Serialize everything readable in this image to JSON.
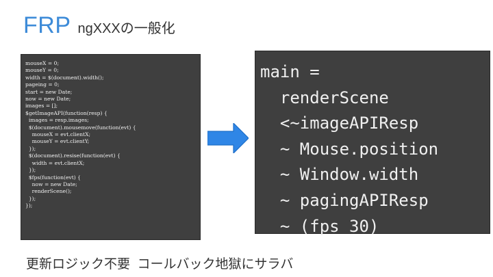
{
  "title": {
    "main": "FRP",
    "sub": "ngXXXの一般化"
  },
  "left_code": {
    "lines": [
      "mouseX = 0;",
      "mouseY = 0;",
      "width = $(document).width();",
      "pageing = 0;",
      "start = new Date;",
      "now = new Date;",
      "images = [];",
      "$getImageAPI(function(resp) {",
      "  images = resp.images;",
      "  $(document).mousemove(function(evt) {",
      "    mouseX = evt.clientX;",
      "    mouseY = evt.clientY;",
      "  });",
      "  $(document).resise(function(evt) {",
      "    width = evt.clientX;",
      "  });",
      "  $fps(function(evt) {",
      "    now = new Date;",
      "    renderScene();",
      "  });",
      "});"
    ]
  },
  "right_code": {
    "lines": [
      "main =",
      "  renderScene",
      "  <~imageAPIResp",
      "  ~ Mouse.position",
      "  ~ Window.width",
      "  ~ pagingAPIResp",
      "  ~ (fps 30)"
    ]
  },
  "arrow": {
    "icon": "right-arrow-icon",
    "color": "#2f86e6"
  },
  "footer": {
    "text": "更新ロジック不要  コールバック地獄にサラバ"
  },
  "colors": {
    "title_accent": "#3d8bd8",
    "code_background": "#3f3f3f",
    "code_text": "#f0f0f0"
  }
}
